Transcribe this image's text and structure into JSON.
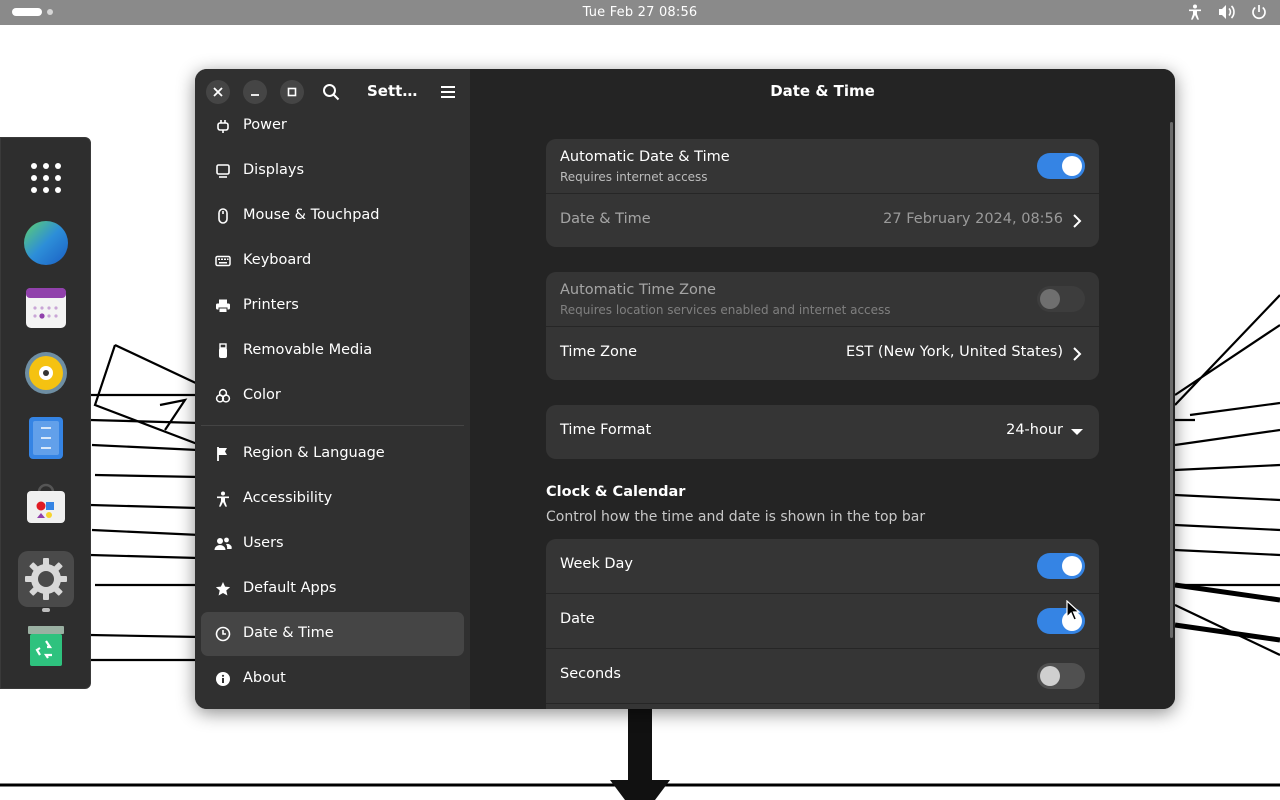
{
  "topbar": {
    "clock": "Tue Feb 27  08:56",
    "tray_icons": [
      "accessibility-icon",
      "volume-icon",
      "power-icon"
    ]
  },
  "dock": {
    "apps": [
      "app-grid-icon",
      "browser-icon",
      "calendar-icon",
      "music-player-icon",
      "text-editor-icon",
      "software-store-icon",
      "settings-icon",
      "trash-icon"
    ],
    "active": "settings-icon"
  },
  "window": {
    "sidebar_title": "Sett…",
    "content_title": "Date & Time",
    "sidebar_items": [
      {
        "label": "Power",
        "icon": "power-plug-icon"
      },
      {
        "label": "Displays",
        "icon": "display-icon"
      },
      {
        "label": "Mouse & Touchpad",
        "icon": "mouse-icon"
      },
      {
        "label": "Keyboard",
        "icon": "keyboard-icon"
      },
      {
        "label": "Printers",
        "icon": "printer-icon"
      },
      {
        "label": "Removable Media",
        "icon": "usb-icon"
      },
      {
        "label": "Color",
        "icon": "color-icon"
      },
      {
        "label": "Region & Language",
        "icon": "flag-icon"
      },
      {
        "label": "Accessibility",
        "icon": "accessibility-icon"
      },
      {
        "label": "Users",
        "icon": "users-icon"
      },
      {
        "label": "Default Apps",
        "icon": "star-icon"
      },
      {
        "label": "Date & Time",
        "icon": "clock-icon"
      },
      {
        "label": "About",
        "icon": "info-icon"
      }
    ],
    "active_item": "Date & Time"
  },
  "datetime": {
    "auto_datetime": {
      "title": "Automatic Date & Time",
      "subtitle": "Requires internet access",
      "enabled": true
    },
    "date_time": {
      "title": "Date & Time",
      "value": "27 February 2024, 08:56"
    },
    "auto_timezone": {
      "title": "Automatic Time Zone",
      "subtitle": "Requires location services enabled and internet access",
      "enabled": false
    },
    "time_zone": {
      "title": "Time Zone",
      "value": "EST (New York, United States)"
    },
    "time_format": {
      "title": "Time Format",
      "value": "24-hour"
    },
    "clock_calendar": {
      "title": "Clock & Calendar",
      "description": "Control how the time and date is shown in the top bar",
      "week_day": {
        "title": "Week Day",
        "enabled": true
      },
      "date": {
        "title": "Date",
        "enabled": true
      },
      "seconds": {
        "title": "Seconds",
        "enabled": false
      }
    }
  },
  "colors": {
    "accent": "#3584e4",
    "window_bg": "#242424",
    "sidebar_bg": "#303030",
    "card_bg": "#353535"
  }
}
